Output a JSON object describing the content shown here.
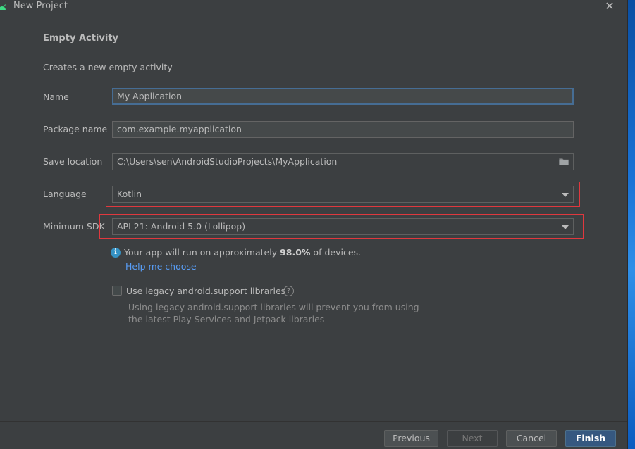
{
  "window": {
    "title": "New Project",
    "close_glyph": "✕"
  },
  "template": {
    "heading": "Empty Activity",
    "description": "Creates a new empty activity"
  },
  "form": {
    "name": {
      "label": "Name",
      "value": "My Application"
    },
    "package": {
      "label": "Package name",
      "value": "com.example.myapplication"
    },
    "save_location": {
      "label": "Save location",
      "value": "C:\\Users\\sen\\AndroidStudioProjects\\MyApplication"
    },
    "language": {
      "label": "Language",
      "value": "Kotlin"
    },
    "min_sdk": {
      "label": "Minimum SDK",
      "value": "API 21: Android 5.0 (Lollipop)"
    }
  },
  "info": {
    "prefix": "Your app will run on approximately ",
    "percent": "98.0%",
    "suffix": " of devices.",
    "help_link": "Help me choose"
  },
  "legacy": {
    "label": "Use legacy android.support libraries",
    "checked": false,
    "note_line1": "Using legacy android.support libraries will prevent you from using",
    "note_line2": "the latest Play Services and Jetpack libraries"
  },
  "buttons": {
    "previous": "Previous",
    "next": "Next",
    "cancel": "Cancel",
    "finish": "Finish"
  },
  "colors": {
    "background": "#3c3f41",
    "highlight": "#e0383e",
    "link": "#589df6",
    "primary_button": "#365880",
    "focus_border": "#466d94"
  }
}
